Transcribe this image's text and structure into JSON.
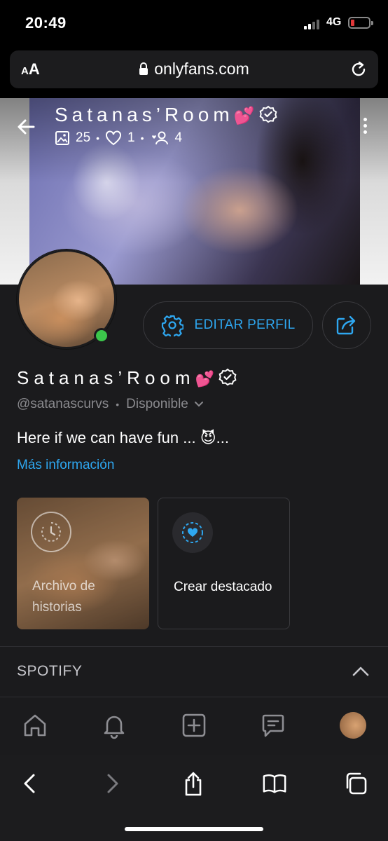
{
  "status_bar": {
    "time": "20:49",
    "network": "4G"
  },
  "browser": {
    "aa_label_small": "A",
    "aa_label_large": "A",
    "url": "onlyfans.com"
  },
  "cover": {
    "title": "Satanas’Room",
    "title_emoji": "💕",
    "stats": {
      "media_count": "25",
      "likes_count": "1",
      "fans_count": "4"
    }
  },
  "profile": {
    "edit_label": "EDITAR PERFIL",
    "name": "Satanas’Room",
    "name_emoji": "💕",
    "handle": "@satanascurvs",
    "separator": "•",
    "availability": "Disponible",
    "bio": "Here if we can have fun ... 😈...",
    "more_info": "Más información"
  },
  "stories": {
    "archive_label": "Archivo de historias",
    "create_label": "Crear destacado"
  },
  "sections": {
    "spotify": "SPOTIFY"
  },
  "colors": {
    "accent": "#2ea7f0",
    "online": "#3cc64b",
    "background": "#1b1b1d"
  },
  "icons": [
    "back-arrow-icon",
    "verified-icon",
    "image-icon",
    "heart-icon",
    "fans-icon",
    "kebab-icon",
    "gear-icon",
    "share-icon",
    "clock-icon",
    "highlight-heart-icon",
    "chevron-up-icon",
    "home-icon",
    "bell-icon",
    "plus-square-icon",
    "message-icon",
    "back-icon",
    "forward-icon",
    "share-sheet-icon",
    "book-icon",
    "tabs-icon"
  ]
}
